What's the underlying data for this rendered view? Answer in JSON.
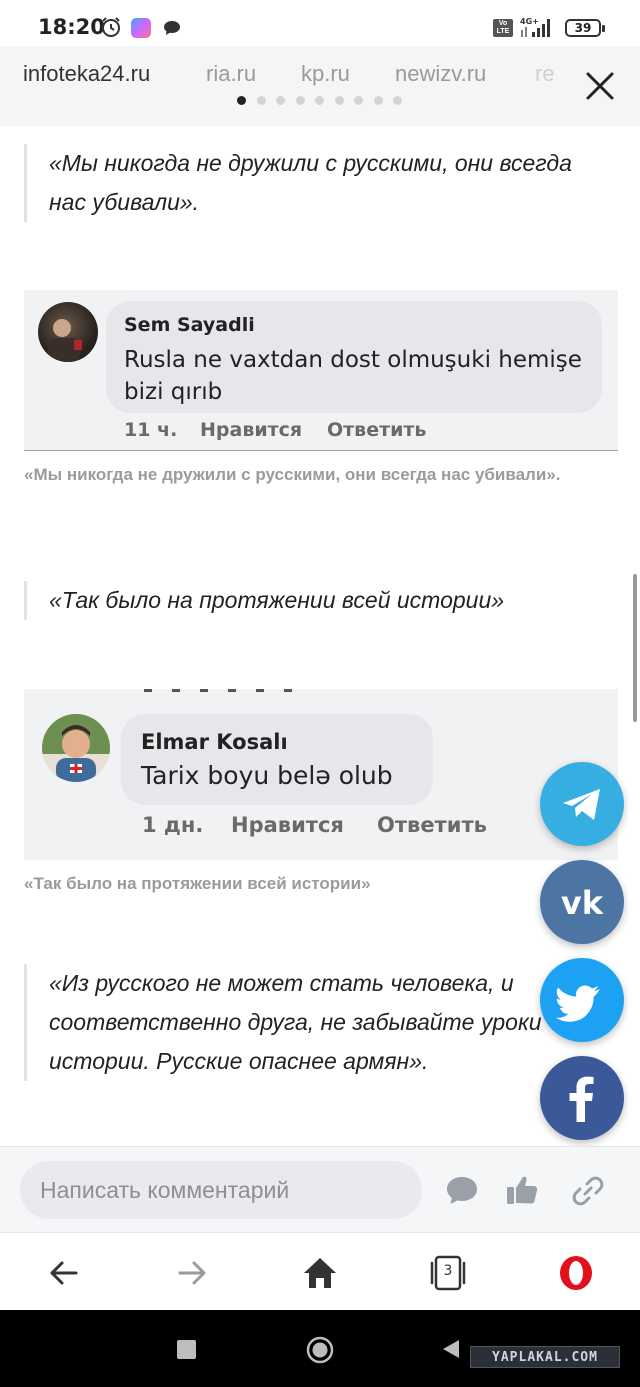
{
  "status": {
    "time": "18:20",
    "battery": "39",
    "network": "4G+"
  },
  "sources": {
    "tabs": [
      "infoteka24.ru",
      "ria.ru",
      "kp.ru",
      "newizv.ru",
      "re"
    ],
    "active_index": 0,
    "page_count": 9
  },
  "article": {
    "quote1": "«Мы никогда не дружили с русскими, они всегда нас убивали».",
    "comment1": {
      "name": "Sem Sayadli",
      "text": "Rusla ne vaxtdan dost olmuşuki hemişe bizi qırıb",
      "time": "11 ч.",
      "like": "Нравится",
      "reply": "Ответить"
    },
    "caption1": "«Мы никогда не дружили с русскими, они всегда нас убивали».",
    "quote2": "«Так было на протяжении всей истории»",
    "comment2": {
      "name": "Elmar Kosalı",
      "text": "Tarix boyu belə olub",
      "time": "1 дн.",
      "like": "Нравится",
      "reply": "Ответить"
    },
    "caption2": "«Так было на протяжении всей истории»",
    "quote3": "«Из русского не может стать человека, и соответственно друга, не забывайте уроки истории. Русские опаснее армян»."
  },
  "share_buttons": [
    "telegram-icon",
    "vk-icon",
    "twitter-icon",
    "facebook-icon"
  ],
  "colors": {
    "telegram": "#37aee2",
    "vk": "#4c75a3",
    "twitter": "#1da1f2",
    "facebook": "#3b5998",
    "opera": "#e0101d"
  },
  "comment_bar": {
    "placeholder": "Написать комментарий"
  },
  "browser": {
    "tab_count": "3"
  },
  "watermark": "YAPLAKAL.COM"
}
